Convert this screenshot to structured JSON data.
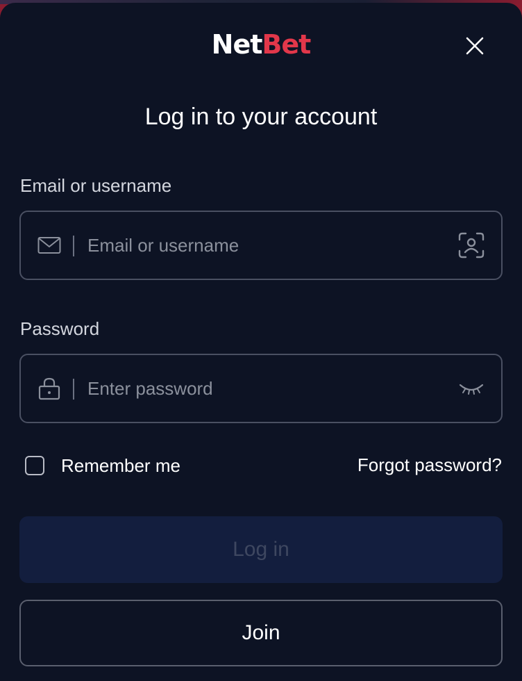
{
  "brand": {
    "logo_part1": "Net",
    "logo_part2": "Bet",
    "color_white": "#ffffff",
    "color_red": "#e2374a"
  },
  "dialog": {
    "title": "Log in to your account",
    "close_icon": "close-icon"
  },
  "email": {
    "label": "Email or username",
    "placeholder": "Email or username",
    "value": "",
    "lead_icon": "mail-icon",
    "trail_icon": "face-scan-icon"
  },
  "password": {
    "label": "Password",
    "placeholder": "Enter password",
    "value": "",
    "lead_icon": "lock-icon",
    "trail_icon": "eye-closed-icon"
  },
  "remember": {
    "label": "Remember me",
    "checked": false
  },
  "forgot": {
    "label": "Forgot password?"
  },
  "actions": {
    "login_label": "Log in",
    "join_label": "Join"
  },
  "colors": {
    "background": "#0d1324",
    "field_border": "#4a5062",
    "login_button_bg": "#131e3e",
    "login_button_text": "#3e4760"
  }
}
